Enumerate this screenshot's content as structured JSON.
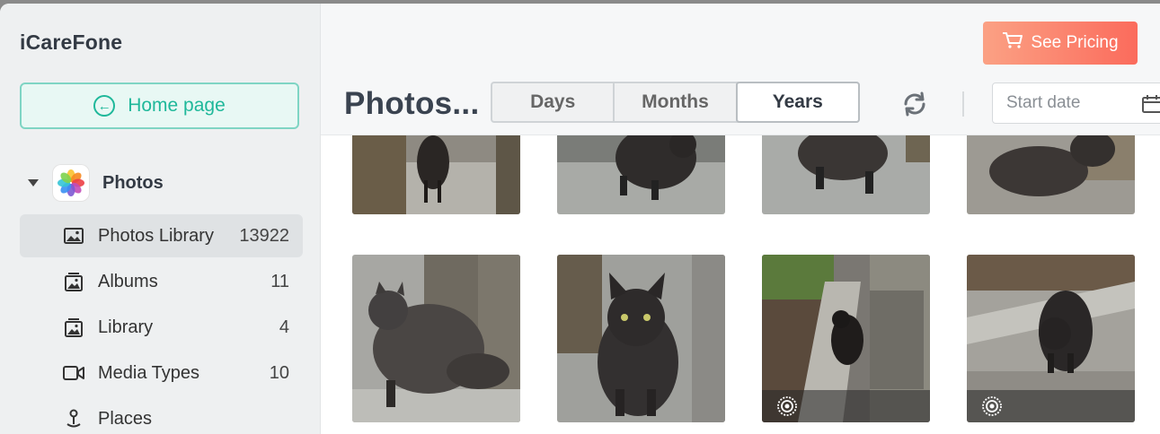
{
  "app": {
    "title": "iCareFone"
  },
  "sidebar": {
    "home_label": "Home page",
    "section_label": "Photos",
    "items": [
      {
        "label": "Photos Library",
        "count": "13922",
        "icon": "image-icon"
      },
      {
        "label": "Albums",
        "count": "11",
        "icon": "album-icon"
      },
      {
        "label": "Library",
        "count": "4",
        "icon": "album-icon"
      },
      {
        "label": "Media Types",
        "count": "10",
        "icon": "video-camera-icon"
      },
      {
        "label": "Places",
        "count": "",
        "icon": "map-pin-icon"
      }
    ]
  },
  "header": {
    "title": "Photos...",
    "pricing_label": "See Pricing",
    "view_options": [
      "Days",
      "Months",
      "Years"
    ],
    "selected_view": "Years",
    "start_date_placeholder": "Start date"
  },
  "colors": {
    "accent": "#1fb89a",
    "pricing_gradient_start": "#fba184",
    "pricing_gradient_end": "#fb6b5c"
  }
}
